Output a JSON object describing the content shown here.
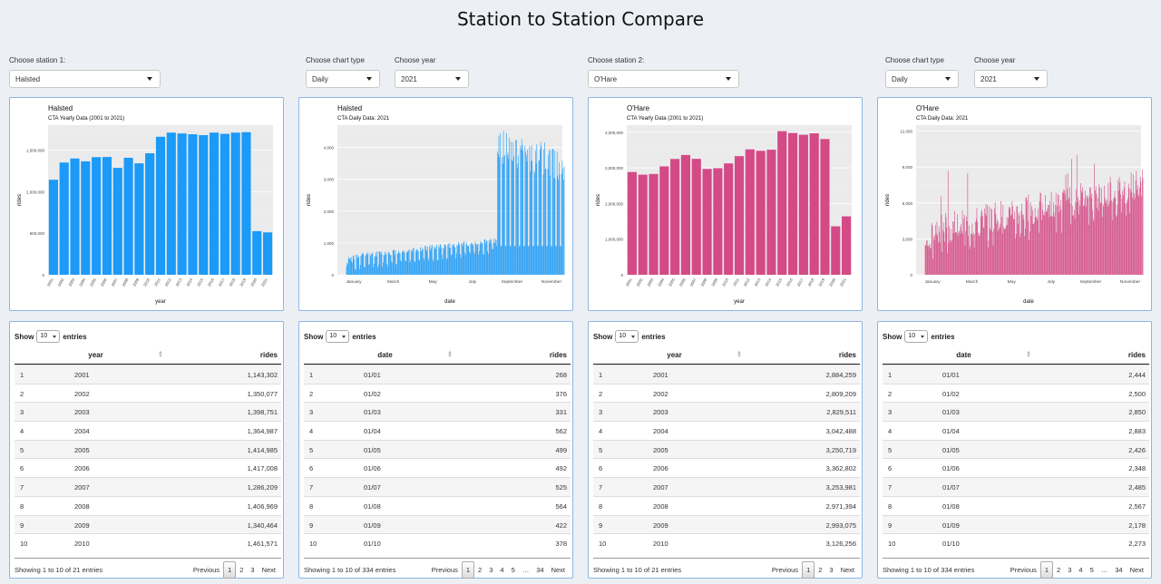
{
  "page_title": "Station to Station Compare",
  "controls": {
    "station1_label": "Choose station 1:",
    "station1_value": "Halsted",
    "chart_type_label_1": "Choose chart type",
    "chart_type_value_1": "Daily",
    "year_label_1": "Choose year",
    "year_value_1": "2021",
    "station2_label": "Choose station 2:",
    "station2_value": "O'Hare",
    "chart_type_label_2": "Choose chart type",
    "chart_type_value_2": "Daily",
    "year_label_2": "Choose year",
    "year_value_2": "2021"
  },
  "colors": {
    "station1": "#1b9af7",
    "station2": "#d44a86"
  },
  "chart_data": [
    {
      "type": "bar",
      "title": "Halsted",
      "subtitle": "CTA Yearly Data (2001 to 2021)",
      "xlabel": "year",
      "ylabel": "rides",
      "categories": [
        "2001",
        "2002",
        "2003",
        "2004",
        "2005",
        "2006",
        "2007",
        "2008",
        "2009",
        "2010",
        "2011",
        "2012",
        "2013",
        "2014",
        "2015",
        "2016",
        "2017",
        "2018",
        "2019",
        "2020",
        "2021"
      ],
      "values": [
        1143302,
        1350077,
        1398751,
        1364987,
        1414985,
        1417008,
        1286209,
        1406969,
        1340464,
        1461571,
        1660000,
        1710000,
        1700000,
        1690000,
        1680000,
        1710000,
        1695000,
        1710000,
        1715000,
        525000,
        510000
      ],
      "yticks": [
        "0",
        "500,000",
        "1,000,000",
        "1,500,000"
      ],
      "ytick_values": [
        0,
        500000,
        1000000,
        1500000
      ],
      "ylim": [
        0,
        1800000
      ],
      "color": "#1b9af7"
    },
    {
      "type": "bar",
      "title": "Halsted",
      "subtitle": "CTA Daily Data: 2021",
      "xlabel": "date",
      "ylabel": "rides",
      "xticks": [
        "January",
        "March",
        "May",
        "July",
        "September",
        "November"
      ],
      "yticks": [
        "0",
        "1,000",
        "2,000",
        "3,000",
        "4,000"
      ],
      "ytick_values": [
        0,
        1000,
        2000,
        3000,
        4000
      ],
      "ylim": [
        0,
        4700
      ],
      "first_values": [
        268,
        376,
        331,
        562,
        499,
        492,
        525,
        564,
        422,
        378
      ],
      "color": "#1b9af7"
    },
    {
      "type": "bar",
      "title": "O'Hare",
      "subtitle": "CTA Yearly Data (2001 to 2021)",
      "xlabel": "year",
      "ylabel": "rides",
      "categories": [
        "2001",
        "2002",
        "2003",
        "2004",
        "2005",
        "2006",
        "2007",
        "2008",
        "2009",
        "2010",
        "2011",
        "2012",
        "2013",
        "2014",
        "2015",
        "2016",
        "2017",
        "2018",
        "2019",
        "2020",
        "2021"
      ],
      "values": [
        2884259,
        2809209,
        2829511,
        3042488,
        3250719,
        3362802,
        3253981,
        2971394,
        2993075,
        3126256,
        3330000,
        3520000,
        3480000,
        3510000,
        4030000,
        3980000,
        3930000,
        3970000,
        3810000,
        1360000,
        1640000
      ],
      "yticks": [
        "0",
        "1,000,000",
        "2,000,000",
        "3,000,000",
        "4,000,000"
      ],
      "ytick_values": [
        0,
        1000000,
        2000000,
        3000000,
        4000000
      ],
      "ylim": [
        0,
        4200000
      ],
      "color": "#d44a86"
    },
    {
      "type": "bar",
      "title": "O'Hare",
      "subtitle": "CTA Daily Data: 2021",
      "xlabel": "date",
      "ylabel": "rides",
      "xticks": [
        "January",
        "March",
        "May",
        "July",
        "September",
        "November"
      ],
      "yticks": [
        "0",
        "3,000",
        "6,000",
        "9,000",
        "12,000"
      ],
      "ytick_values": [
        0,
        3000,
        6000,
        9000,
        12000
      ],
      "ylim": [
        0,
        12500
      ],
      "first_values": [
        2444,
        2500,
        2850,
        2883,
        2426,
        2348,
        2485,
        2567,
        2178,
        2273
      ],
      "color": "#d44a86"
    }
  ],
  "tables": [
    {
      "show_label": "Show",
      "entries_label": "entries",
      "length_value": "10",
      "col1": "year",
      "col2": "rides",
      "rows": [
        [
          "1",
          "2001",
          "1,143,302"
        ],
        [
          "2",
          "2002",
          "1,350,077"
        ],
        [
          "3",
          "2003",
          "1,398,751"
        ],
        [
          "4",
          "2004",
          "1,364,987"
        ],
        [
          "5",
          "2005",
          "1,414,985"
        ],
        [
          "6",
          "2006",
          "1,417,008"
        ],
        [
          "7",
          "2007",
          "1,286,209"
        ],
        [
          "8",
          "2008",
          "1,406,969"
        ],
        [
          "9",
          "2009",
          "1,340,464"
        ],
        [
          "10",
          "2010",
          "1,461,571"
        ]
      ],
      "info": "Showing 1 to 10 of 21 entries",
      "pager": [
        "Previous",
        "1",
        "2",
        "3",
        "Next"
      ]
    },
    {
      "show_label": "Show",
      "entries_label": "entries",
      "length_value": "10",
      "col1": "date",
      "col2": "rides",
      "rows": [
        [
          "1",
          "01/01",
          "268"
        ],
        [
          "2",
          "01/02",
          "376"
        ],
        [
          "3",
          "01/03",
          "331"
        ],
        [
          "4",
          "01/04",
          "562"
        ],
        [
          "5",
          "01/05",
          "499"
        ],
        [
          "6",
          "01/06",
          "492"
        ],
        [
          "7",
          "01/07",
          "525"
        ],
        [
          "8",
          "01/08",
          "564"
        ],
        [
          "9",
          "01/09",
          "422"
        ],
        [
          "10",
          "01/10",
          "378"
        ]
      ],
      "info": "Showing 1 to 10 of 334 entries",
      "pager": [
        "Previous",
        "1",
        "2",
        "3",
        "4",
        "5",
        "…",
        "34",
        "Next"
      ]
    },
    {
      "show_label": "Show",
      "entries_label": "entries",
      "length_value": "10",
      "col1": "year",
      "col2": "rides",
      "rows": [
        [
          "1",
          "2001",
          "2,884,259"
        ],
        [
          "2",
          "2002",
          "2,809,209"
        ],
        [
          "3",
          "2003",
          "2,829,511"
        ],
        [
          "4",
          "2004",
          "3,042,488"
        ],
        [
          "5",
          "2005",
          "3,250,719"
        ],
        [
          "6",
          "2006",
          "3,362,802"
        ],
        [
          "7",
          "2007",
          "3,253,981"
        ],
        [
          "8",
          "2008",
          "2,971,394"
        ],
        [
          "9",
          "2009",
          "2,993,075"
        ],
        [
          "10",
          "2010",
          "3,126,256"
        ]
      ],
      "info": "Showing 1 to 10 of 21 entries",
      "pager": [
        "Previous",
        "1",
        "2",
        "3",
        "Next"
      ]
    },
    {
      "show_label": "Show",
      "entries_label": "entries",
      "length_value": "10",
      "col1": "date",
      "col2": "rides",
      "rows": [
        [
          "1",
          "01/01",
          "2,444"
        ],
        [
          "2",
          "01/02",
          "2,500"
        ],
        [
          "3",
          "01/03",
          "2,850"
        ],
        [
          "4",
          "01/04",
          "2,883"
        ],
        [
          "5",
          "01/05",
          "2,426"
        ],
        [
          "6",
          "01/06",
          "2,348"
        ],
        [
          "7",
          "01/07",
          "2,485"
        ],
        [
          "8",
          "01/08",
          "2,567"
        ],
        [
          "9",
          "01/09",
          "2,178"
        ],
        [
          "10",
          "01/10",
          "2,273"
        ]
      ],
      "info": "Showing 1 to 10 of 334 entries",
      "pager": [
        "Previous",
        "1",
        "2",
        "3",
        "4",
        "5",
        "…",
        "34",
        "Next"
      ]
    }
  ]
}
